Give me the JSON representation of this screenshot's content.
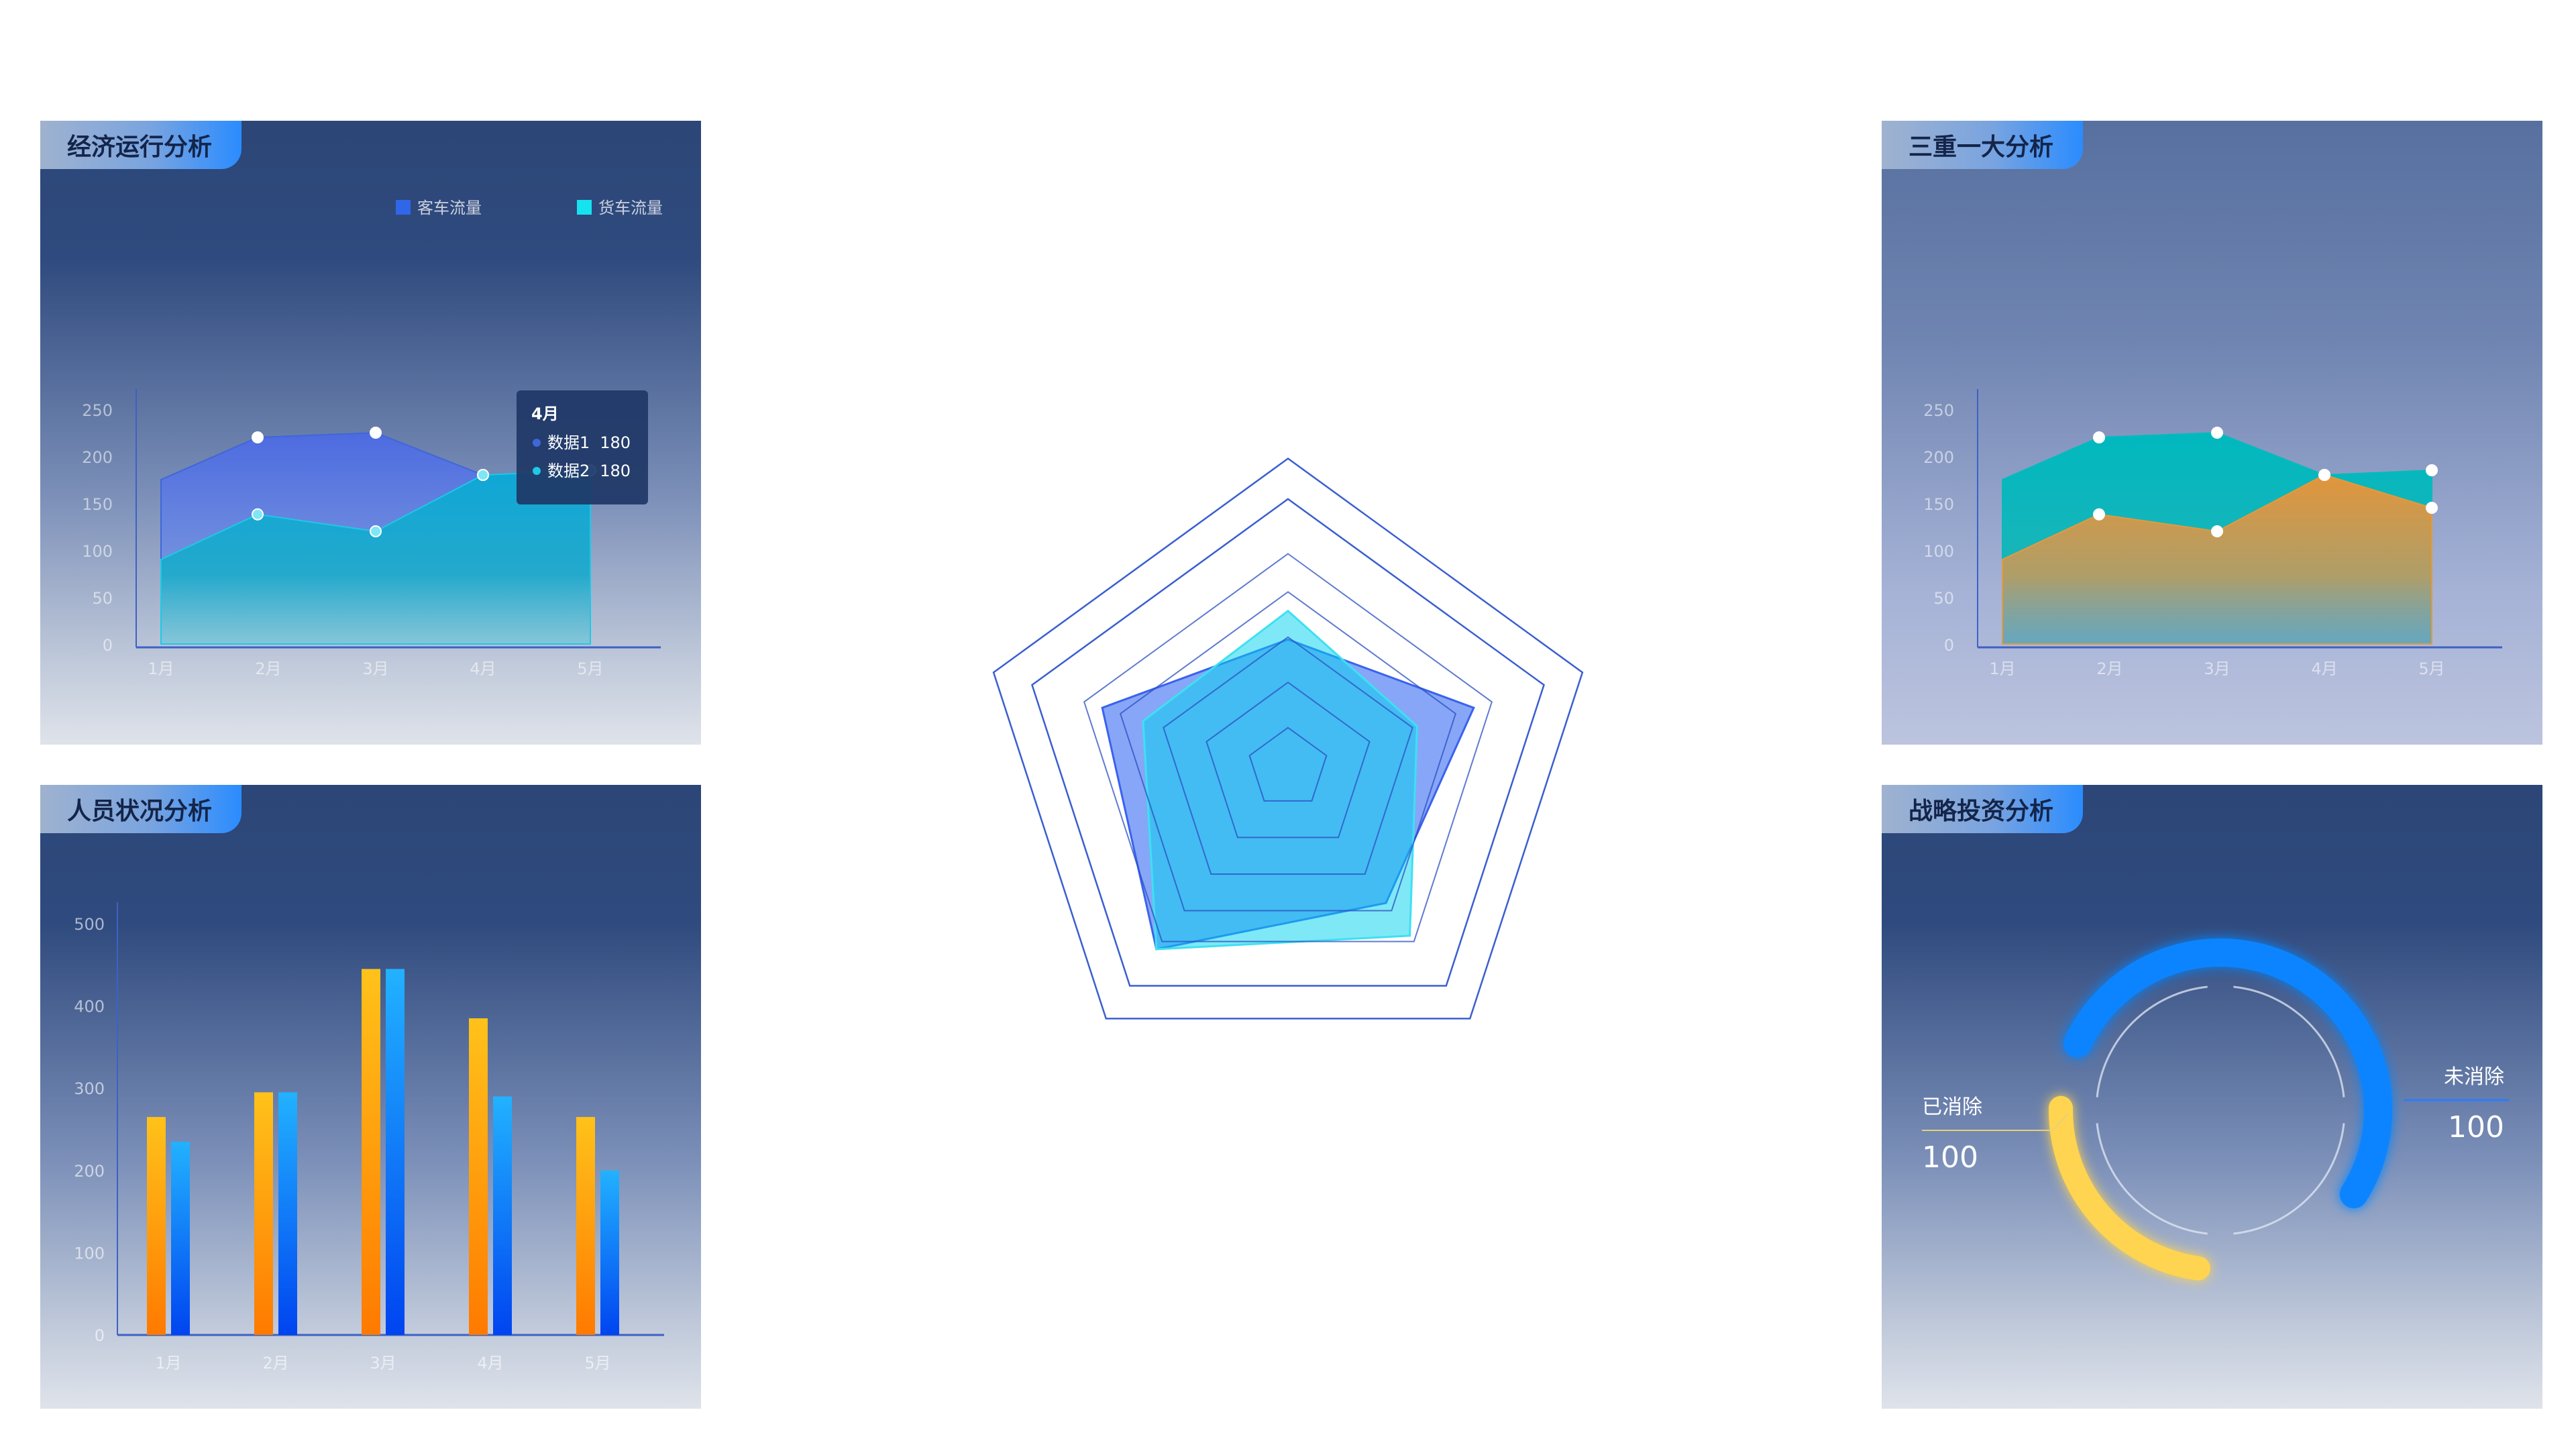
{
  "panels": {
    "economy": {
      "title": "经济运行分析"
    },
    "personnel": {
      "title": "人员状况分析"
    },
    "triple": {
      "title": "三重一大分析"
    },
    "strategy": {
      "title": "战略投资分析"
    }
  },
  "chart_data": [
    {
      "id": "economy",
      "type": "area",
      "categories": [
        "1月",
        "2月",
        "3月",
        "4月",
        "5月"
      ],
      "yticks": [
        0,
        50,
        100,
        150,
        200,
        250
      ],
      "ylim": [
        0,
        250
      ],
      "legend": [
        "客车流量",
        "货车流量"
      ],
      "series": [
        {
          "name": "客车流量",
          "color": "#3f67d9",
          "x": [
            1,
            1.9,
            3,
            4,
            5
          ],
          "values": [
            175,
            220,
            225,
            180,
            185
          ]
        },
        {
          "name": "货车流量",
          "color": "#1ec8e6",
          "x": [
            1,
            1.9,
            3,
            4,
            5
          ],
          "values": [
            90,
            138,
            120,
            180,
            185
          ]
        }
      ],
      "tooltip": {
        "title": "4月",
        "rows": [
          {
            "label": "数据1",
            "value": "180"
          },
          {
            "label": "数据2",
            "value": "180"
          }
        ]
      }
    },
    {
      "id": "personnel",
      "type": "bar",
      "categories": [
        "1月",
        "2月",
        "3月",
        "4月",
        "5月"
      ],
      "yticks": [
        0,
        100,
        200,
        300,
        400,
        500
      ],
      "ylim": [
        0,
        500
      ],
      "series": [
        {
          "color": "#ffb300",
          "values": [
            265,
            295,
            445,
            385,
            265
          ]
        },
        {
          "color": "#1f8dff",
          "values": [
            235,
            295,
            445,
            290,
            200
          ]
        }
      ]
    },
    {
      "id": "triple",
      "type": "area",
      "categories": [
        "1月",
        "2月",
        "3月",
        "4月",
        "5月"
      ],
      "yticks": [
        0,
        50,
        100,
        150,
        200,
        250
      ],
      "ylim": [
        0,
        250
      ],
      "series": [
        {
          "color": "#00bcbc",
          "x": [
            1,
            1.9,
            3,
            4,
            5
          ],
          "values": [
            175,
            220,
            225,
            180,
            185
          ]
        },
        {
          "color": "#e8983a",
          "x": [
            1,
            1.9,
            3,
            4,
            5
          ],
          "values": [
            90,
            138,
            120,
            180,
            145
          ]
        }
      ]
    },
    {
      "id": "radar",
      "type": "radar",
      "axes": 5,
      "max": 100,
      "series": [
        {
          "color": "#3a62ee",
          "values": [
            54,
            82,
            70,
            94,
            82
          ]
        },
        {
          "color": "#3ee0f2",
          "values": [
            66,
            57,
            87,
            94,
            64
          ]
        }
      ]
    },
    {
      "id": "strategy",
      "type": "pie",
      "slices": [
        {
          "label": "已消除",
          "value": "100",
          "color": "#ffd451",
          "sweep": 0.23
        },
        {
          "label": "未消除",
          "value": "100",
          "color": "#0a84ff",
          "sweep": 0.52
        }
      ]
    }
  ]
}
